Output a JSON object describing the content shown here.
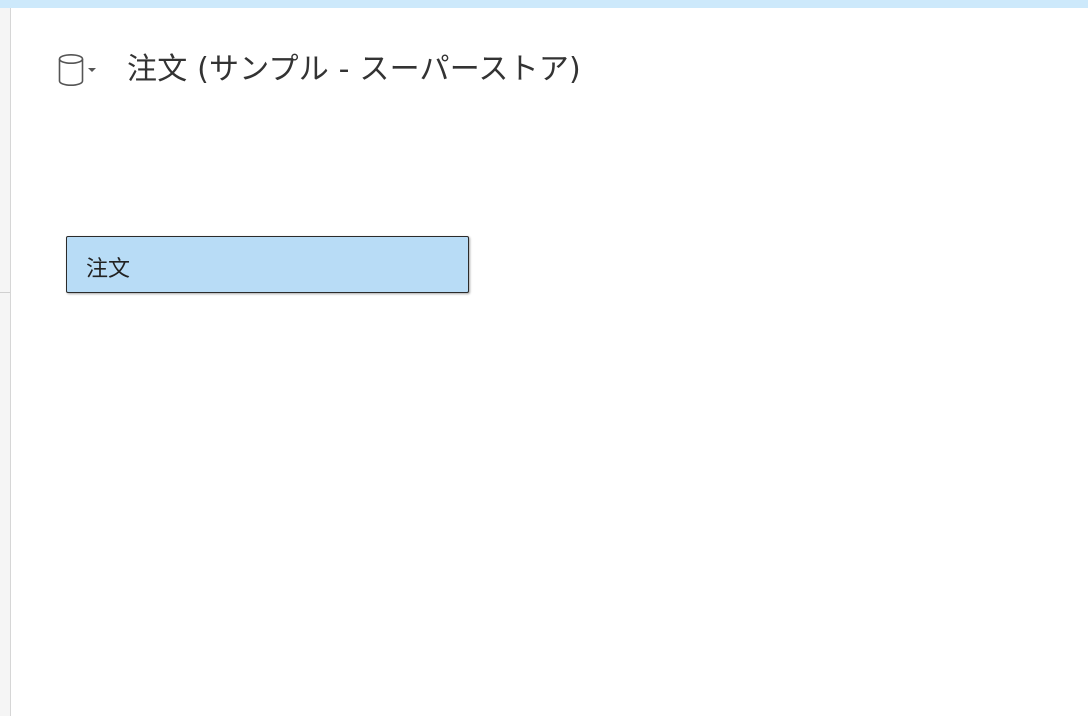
{
  "datasource": {
    "icon": "database-icon",
    "menu_icon": "chevron-down-icon",
    "title": "注文 (サンプル - スーパーストア)"
  },
  "canvas": {
    "tables": [
      {
        "label": "注文"
      }
    ]
  },
  "colors": {
    "top_strip": "#cde9fb",
    "table_fill": "#b8dcf6",
    "table_border": "#2b2b2b",
    "text": "#333333"
  }
}
